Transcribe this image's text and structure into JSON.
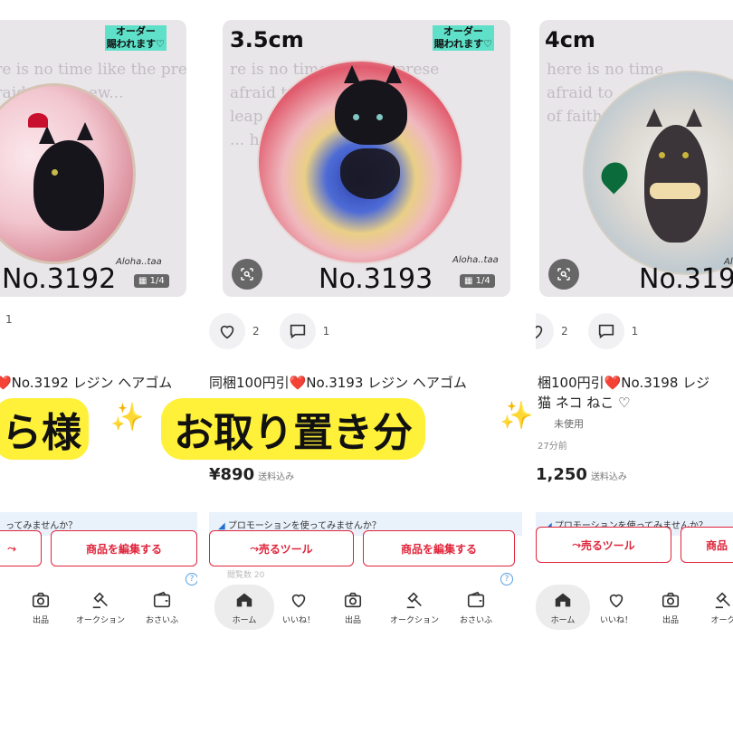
{
  "panels": [
    {
      "size_label": "",
      "order_badge": [
        "オーダー",
        "賜われます♡"
      ],
      "quote": "...re is no time like the prese\nafraid to try new...\nleap of faith...\nnow.",
      "signature": "Aloha..taa",
      "item_number": "No.3192",
      "image_count": "1/4",
      "likes": "",
      "comments": "1",
      "title_line1": "❤️No.3192 レジン ヘアゴム",
      "title_line2": "",
      "condition": "",
      "time_ago": "",
      "price": "",
      "price_note": "",
      "promo": "ってみませんか？",
      "button_secondary": "商品を編集する",
      "footer_faint": ""
    },
    {
      "size_label": "3.5cm",
      "order_badge": [
        "オーダー",
        "賜われます♡"
      ],
      "quote": "re is no time like the prese\nafraid to try new\nleap of faith and watch\n... how.",
      "signature": "Aloha..taa",
      "item_number": "No.3193",
      "image_count": "1/4",
      "likes": "2",
      "comments": "1",
      "title_line1": "同梱100円引❤️No.3193 レジン ヘアゴム",
      "title_line2": "",
      "condition": "",
      "time_ago": "",
      "price": "¥890",
      "price_note": "送料込み",
      "promo": "プロモーションを使ってみませんか？",
      "button_primary": "売るツール",
      "button_secondary": "商品を編集する",
      "footer_faint": "閲覧数 20"
    },
    {
      "size_label": "4cm",
      "order_badge": [],
      "quote": "here is no time\nafraid to\nof faith",
      "signature": "Alo",
      "item_number": "No.319",
      "image_count": "",
      "likes": "2",
      "comments": "1",
      "title_line1": "梱100円引❤️No.3198 レジ",
      "title_line2": "猫 ネコ ねこ ♡",
      "condition": "未使用",
      "time_ago": "27分前",
      "price": "1,250",
      "price_note": "送料込み",
      "promo": "プロモーションを使ってみませんか？",
      "button_primary": "売るツール",
      "button_secondary": "商品",
      "footer_faint": ""
    }
  ],
  "tabs": {
    "home": "ホーム",
    "likes": "いいね！",
    "sell": "出品",
    "auction": "オークション",
    "wallet": "おさいふ",
    "auction_short": "オーク"
  },
  "banner": {
    "left_text": "ら様",
    "main_text": "お取り置き分",
    "sparkle": "✨"
  },
  "colors": {
    "accent_red": "#e0243b",
    "banner_yellow": "#fff03a",
    "badge_teal": "#5ee0c9",
    "promo_blue": "#e9f1fb"
  }
}
